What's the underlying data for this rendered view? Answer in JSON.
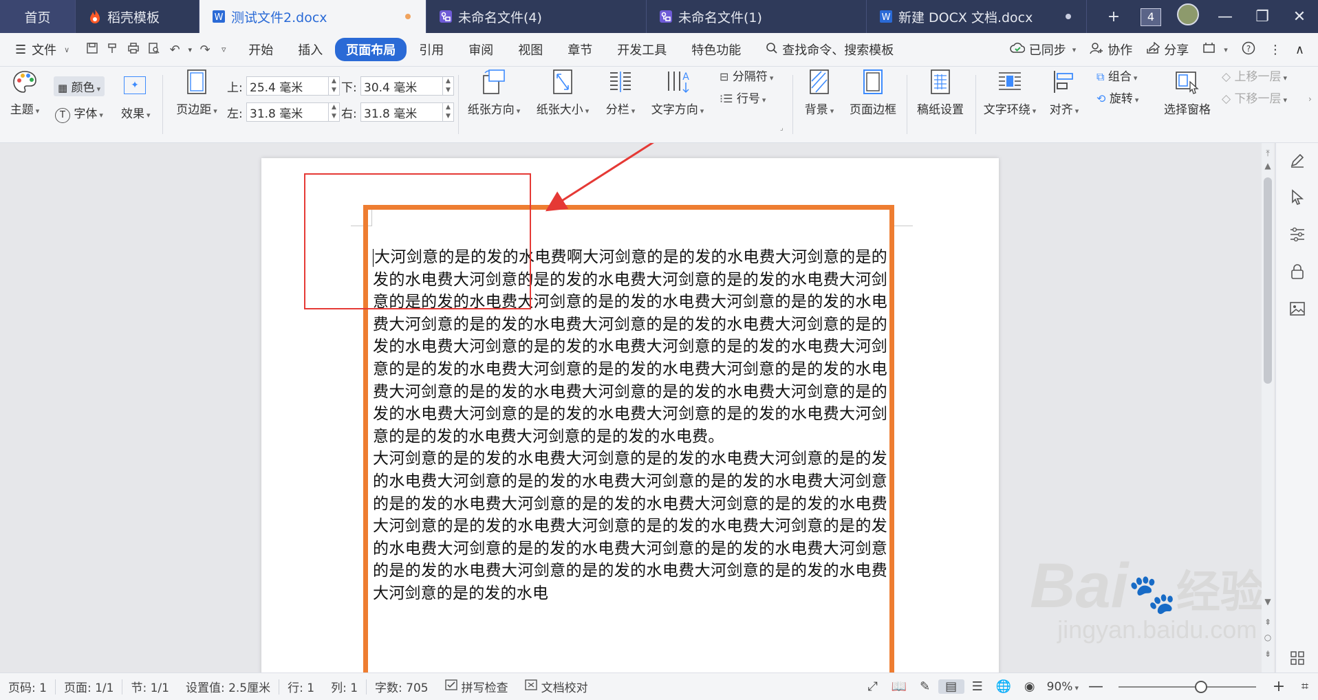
{
  "tabs": [
    {
      "label": "首页",
      "icon": "home",
      "active": false
    },
    {
      "label": "稻壳模板",
      "icon": "docer-flame-icon",
      "active": false
    },
    {
      "label": "测试文件2.docx",
      "icon": "wps-writer-icon",
      "active": true,
      "dot_color": "#f0a35e"
    },
    {
      "label": "未命名文件(4)",
      "icon": "flowchart-icon",
      "active": false
    },
    {
      "label": "未命名文件(1)",
      "icon": "flowchart-icon",
      "active": false
    },
    {
      "label": "新建 DOCX 文档.docx",
      "icon": "wps-writer-icon",
      "active": false,
      "dot_color": "#c9cde0"
    }
  ],
  "tabbar": {
    "new_tab": "+",
    "tab_count": "4",
    "minimize": "—",
    "restore": "❐",
    "close": "✕"
  },
  "menubar": {
    "file": "文件",
    "items": [
      "开始",
      "插入",
      "页面布局",
      "引用",
      "审阅",
      "视图",
      "章节",
      "开发工具",
      "特色功能"
    ],
    "active": "页面布局",
    "search": "查找命令、搜索模板",
    "synced": "已同步",
    "collaborate": "协作",
    "share": "分享"
  },
  "ribbon": {
    "theme": "主题",
    "color": "颜色",
    "font": "字体",
    "effect": "效果",
    "margins": "页边距",
    "margin_top_label": "上:",
    "margin_top": "25.4 毫米",
    "margin_bottom_label": "下:",
    "margin_bottom": "30.4 毫米",
    "margin_left_label": "左:",
    "margin_left": "31.8 毫米",
    "margin_right_label": "右:",
    "margin_right": "31.8 毫米",
    "orientation": "纸张方向",
    "paper_size": "纸张大小",
    "columns": "分栏",
    "text_direction": "文字方向",
    "breaks": "分隔符",
    "line_numbers": "行号",
    "background": "背景",
    "page_border": "页面边框",
    "manuscript": "稿纸设置",
    "text_wrap": "文字环绕",
    "align": "对齐",
    "group": "组合",
    "rotate": "旋转",
    "selection_pane": "选择窗格",
    "bring_forward": "上移一层",
    "send_backward": "下移一层"
  },
  "document": {
    "paragraph1": "大河剑意的是的发的水电费啊大河剑意的是的发的水电费大河剑意的是的发的水电费大河剑意的是的发的水电费大河剑意的是的发的水电费大河剑意的是的发的水电费大河剑意的是的发的水电费大河剑意的是的发的水电费大河剑意的是的发的水电费大河剑意的是的发的水电费大河剑意的是的发的水电费大河剑意的是的发的水电费大河剑意的是的发的水电费大河剑意的是的发的水电费大河剑意的是的发的水电费大河剑意的是的发的水电费大河剑意的是的发的水电费大河剑意的是的发的水电费大河剑意的是的发的水电费大河剑意的是的发的水电费大河剑意的是的发的水电费大河剑意的是的发的水电费大河剑意的是的发的水电费。",
    "paragraph2": "大河剑意的是的发的水电费大河剑意的是的发的水电费大河剑意的是的发的水电费大河剑意的是的发的水电费大河剑意的是的发的水电费大河剑意的是的发的水电费大河剑意的是的发的水电费大河剑意的是的发的水电费大河剑意的是的发的水电费大河剑意的是的发的水电费大河剑意的是的发的水电费大河剑意的是的发的水电费大河剑意的是的发的水电费大河剑意的是的发的水电费大河剑意的是的发的水电费大河剑意的是的发的水电费大河剑意的是的发的水电"
  },
  "watermark": {
    "line1": "Bai",
    "line1b": "经验",
    "line2": "jingyan.baidu.com"
  },
  "statusbar": {
    "page_num": "页码: 1",
    "pages": "页面: 1/1",
    "section": "节: 1/1",
    "setting": "设置值: 2.5厘米",
    "row": "行: 1",
    "col": "列: 1",
    "word_count": "字数: 705",
    "spell_check": "拼写检查",
    "doc_proof": "文档校对",
    "zoom": "90%",
    "zoom_fraction": 0.6
  },
  "colors": {
    "accent": "#2a6ad6",
    "border_orange": "#ee7d31",
    "highlight_red": "#e53935",
    "tabbar": "#2f3a5a"
  }
}
